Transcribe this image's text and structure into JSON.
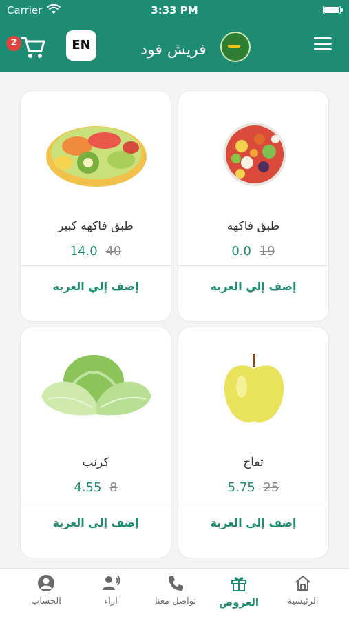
{
  "status_bar": {
    "carrier": "Carrier",
    "time": "3:33 PM"
  },
  "header": {
    "title": "فريش فود",
    "language_button": "EN",
    "cart_count": "2",
    "brand_color": "#1e8c73"
  },
  "products": [
    {
      "name": "طبق فاكهه",
      "price": "0.0",
      "old_price": "19",
      "add_label": "إضف إلي العربة",
      "image": "fruit-bowl"
    },
    {
      "name": "طبق فاكهه كبير",
      "price": "14.0",
      "old_price": "40",
      "add_label": "إضف إلي العربة",
      "image": "fruit-platter"
    },
    {
      "name": "تفاح",
      "price": "5.75",
      "old_price": "25",
      "add_label": "إضف إلي العربة",
      "image": "apple"
    },
    {
      "name": "كرنب",
      "price": "4.55",
      "old_price": "8",
      "add_label": "إضف إلي العربة",
      "image": "cabbage"
    }
  ],
  "tabs": [
    {
      "label": "الرئيسية",
      "icon": "home-icon"
    },
    {
      "label": "العروض",
      "icon": "gift-icon",
      "active": true
    },
    {
      "label": "تواصل معنا",
      "icon": "phone-icon"
    },
    {
      "label": "اراء",
      "icon": "feedback-icon"
    },
    {
      "label": "الحساب",
      "icon": "account-icon"
    }
  ]
}
